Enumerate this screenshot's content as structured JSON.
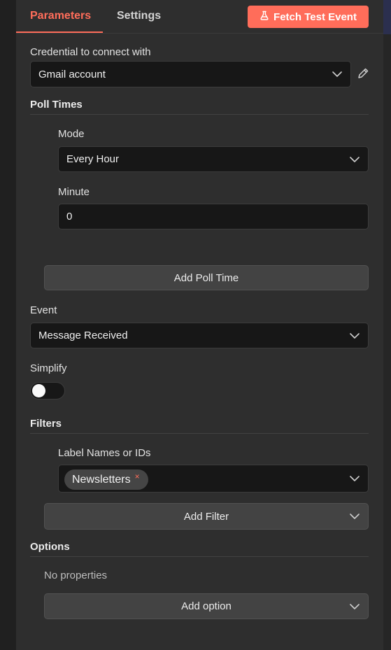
{
  "tabs": [
    {
      "label": "Parameters",
      "active": true
    },
    {
      "label": "Settings",
      "active": false
    }
  ],
  "fetch_button": {
    "label": "Fetch Test Event",
    "icon": "flask-icon"
  },
  "credential": {
    "label": "Credential to connect with",
    "value": "Gmail account"
  },
  "poll_times": {
    "title": "Poll Times",
    "mode_label": "Mode",
    "mode_value": "Every Hour",
    "minute_label": "Minute",
    "minute_value": "0",
    "add_label": "Add Poll Time"
  },
  "event": {
    "label": "Event",
    "value": "Message Received"
  },
  "simplify": {
    "label": "Simplify",
    "enabled": false
  },
  "filters": {
    "title": "Filters",
    "label_names_label": "Label Names or IDs",
    "chips": [
      "Newsletters"
    ],
    "chip_remove": "×",
    "add_label": "Add Filter"
  },
  "options": {
    "title": "Options",
    "empty_text": "No properties",
    "add_label": "Add option"
  },
  "colors": {
    "accent": "#ff6d5a",
    "panel": "#2e2e2e",
    "field": "#171717"
  }
}
